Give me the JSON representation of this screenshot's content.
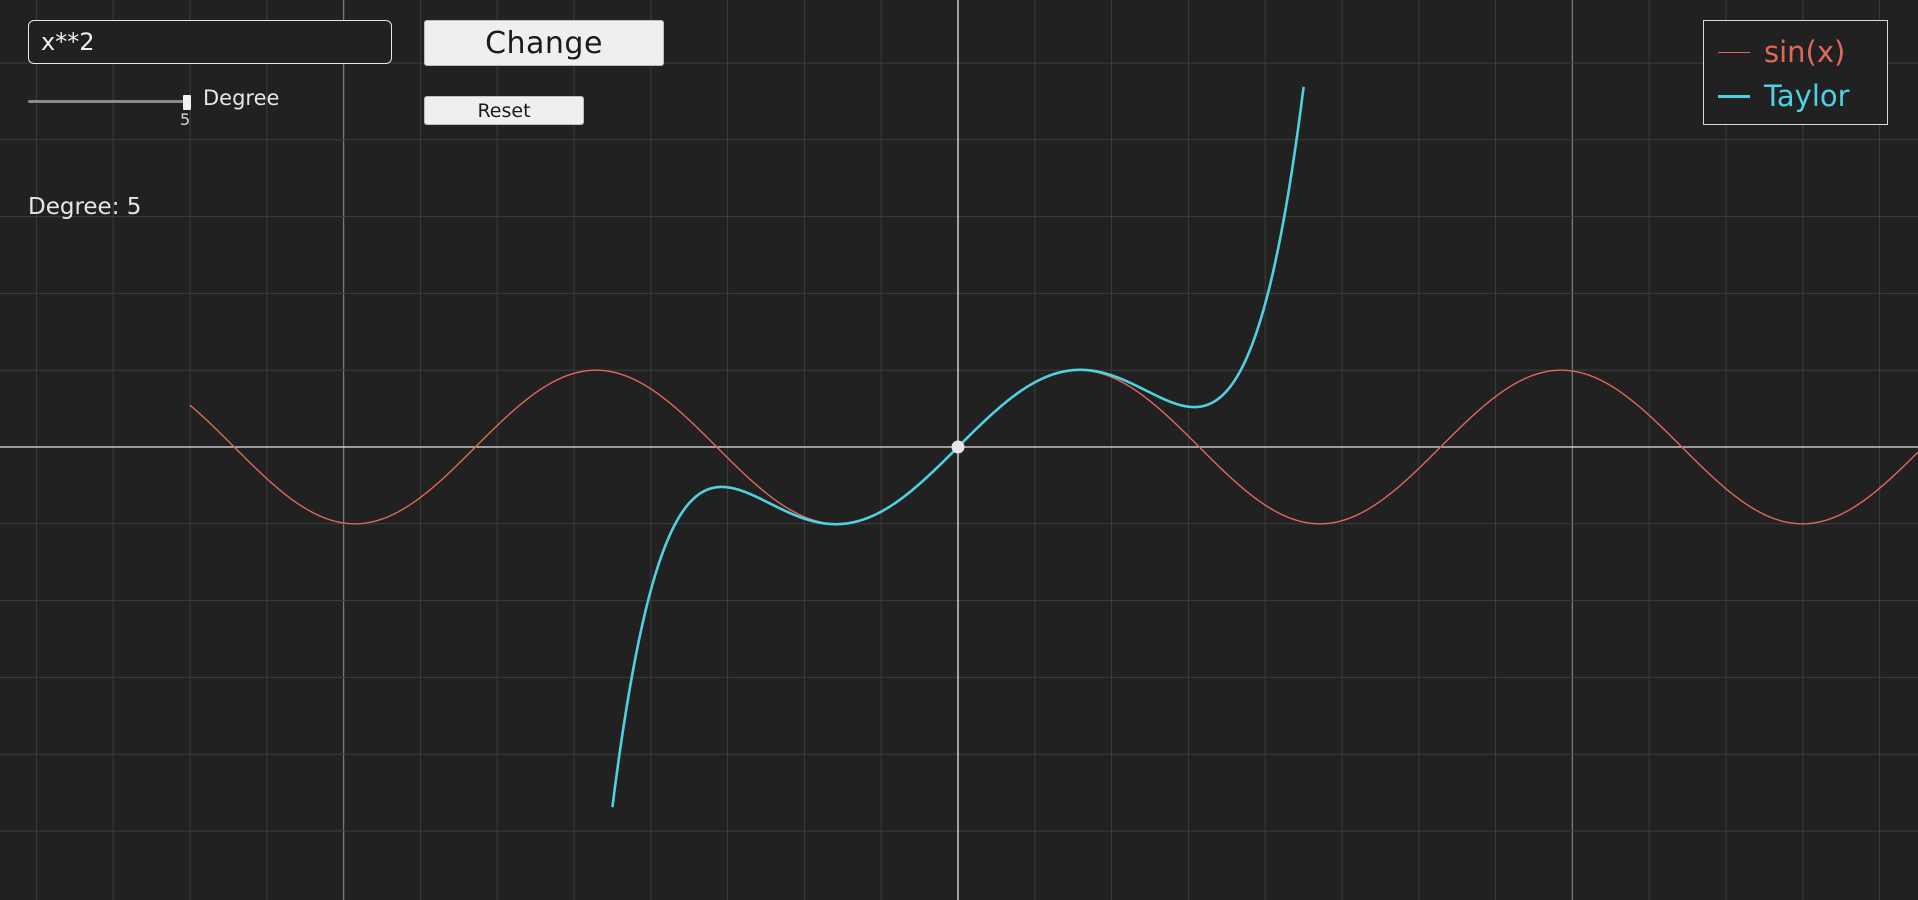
{
  "controls": {
    "expression_value": "x**2",
    "change_label": "Change",
    "reset_label": "Reset",
    "slider_label": "Degree",
    "slider_value": "5",
    "status_text": "Degree: 5"
  },
  "legend": {
    "items": [
      {
        "label": "sin(x)",
        "color": "#e0685a"
      },
      {
        "label": "Taylor",
        "color": "#4fd0e3"
      }
    ]
  },
  "chart_data": {
    "type": "line",
    "title": "",
    "xlabel": "",
    "ylabel": "",
    "xlim": [
      -10,
      12.5
    ],
    "ylim": [
      -5.3,
      5.3
    ],
    "grid": true,
    "legend_position": "top-right",
    "background": "#212121",
    "grid_color": "#3d3d3d",
    "axis_color": "#e6e6e6",
    "taylor_degree": 5,
    "marked_point": [
      0,
      0
    ],
    "series": [
      {
        "name": "sin(x)",
        "function": "sin(x)",
        "color": "#e0685a",
        "xrange": [
          -10,
          12.5
        ]
      },
      {
        "name": "Taylor",
        "function": "x - x^3/6 + x^5/120",
        "color": "#4fd0e3",
        "xrange": [
          -4.5,
          4.5
        ]
      }
    ]
  }
}
